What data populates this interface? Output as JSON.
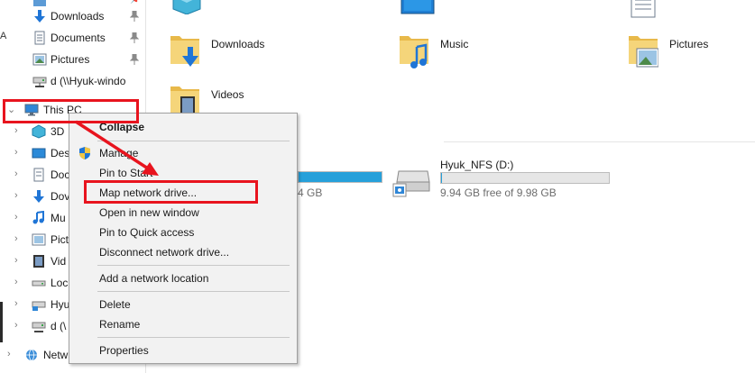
{
  "nav": {
    "items": [
      {
        "label": "Downloads",
        "icon": "download-arrow-icon",
        "pinned": true
      },
      {
        "label": "Documents",
        "icon": "document-icon",
        "pinned": true
      },
      {
        "label": "Pictures",
        "icon": "pictures-icon",
        "pinned": true
      },
      {
        "label": "d (\\\\Hyuk-windo",
        "icon": "network-drive-icon",
        "pinned": false
      },
      {
        "label": "This PC",
        "icon": "computer-icon",
        "expanded": true
      },
      {
        "label": "3D",
        "icon": "3d-objects-icon"
      },
      {
        "label": "Des",
        "icon": "desktop-icon"
      },
      {
        "label": "Doc",
        "icon": "document-icon"
      },
      {
        "label": "Dov",
        "icon": "download-arrow-icon"
      },
      {
        "label": "Mu",
        "icon": "music-icon"
      },
      {
        "label": "Pict",
        "icon": "pictures-icon"
      },
      {
        "label": "Vid",
        "icon": "videos-icon"
      },
      {
        "label": "Loc",
        "icon": "local-disk-icon"
      },
      {
        "label": "Hyu",
        "icon": "nfs-drive-icon"
      },
      {
        "label": "d (\\",
        "icon": "network-drive-icon"
      },
      {
        "label": "Netw",
        "icon": "network-icon"
      }
    ],
    "edge_letter": "A"
  },
  "main": {
    "folders": [
      {
        "label": "Downloads",
        "icon": "downloads-folder-icon"
      },
      {
        "label": "Music",
        "icon": "music-folder-icon"
      },
      {
        "label": "Pictures",
        "icon": "pictures-folder-icon"
      },
      {
        "label": "Videos",
        "icon": "videos-folder-icon"
      }
    ],
    "drives": [
      {
        "name": "",
        "free": "4 GB",
        "used_fraction": 1.0,
        "icon": "local-disk-icon"
      },
      {
        "name": "Hyuk_NFS (D:)",
        "free": "9.94 GB free of 9.98 GB",
        "used_fraction": 0.004,
        "icon": "nfs-drive-icon"
      }
    ]
  },
  "context_menu": {
    "items": [
      {
        "label": "Collapse",
        "bold": true
      },
      {
        "label": "Manage",
        "icon": "uac-shield-icon"
      },
      {
        "label": "Pin to Start"
      },
      {
        "label": "Map network drive..."
      },
      {
        "label": "Open in new window"
      },
      {
        "label": "Pin to Quick access"
      },
      {
        "label": "Disconnect network drive..."
      },
      {
        "label": "Add a network location"
      },
      {
        "label": "Delete"
      },
      {
        "label": "Rename"
      },
      {
        "label": "Properties"
      }
    ]
  },
  "colors": {
    "annotation_red": "#e8141e",
    "progress_blue": "#26a0da",
    "menu_bg": "#f2f2f2"
  }
}
